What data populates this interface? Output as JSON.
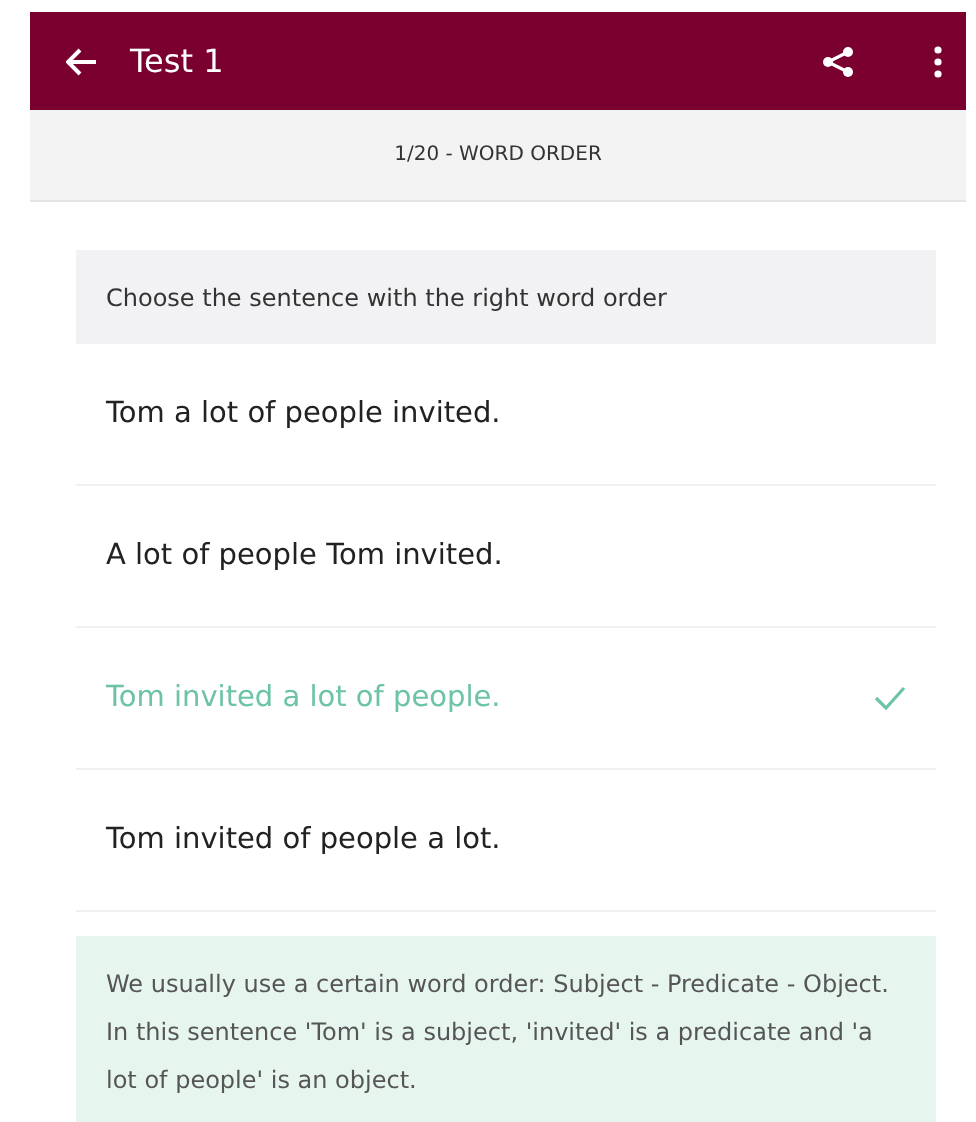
{
  "app_bar": {
    "title": "Test 1"
  },
  "subheader": {
    "text": "1/20 - WORD ORDER"
  },
  "question": {
    "prompt": "Choose the sentence with the right word order"
  },
  "options": [
    {
      "text": "Tom a lot of people invited.",
      "selected": false
    },
    {
      "text": "A lot of people Tom invited.",
      "selected": false
    },
    {
      "text": "Tom invited a lot of people.",
      "selected": true
    },
    {
      "text": "Tom invited of people a lot.",
      "selected": false
    }
  ],
  "explanation": {
    "text": "We usually use a certain word order: Subject - Predicate - Object. In this sentence 'Tom' is a subject, 'invited' is a predicate and 'a lot of people' is an object."
  }
}
